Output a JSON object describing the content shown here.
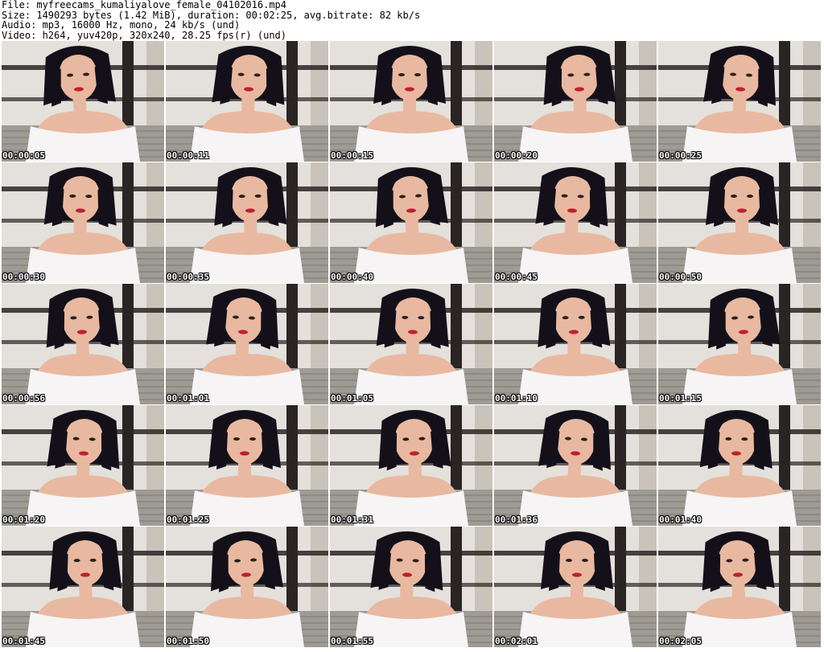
{
  "header": {
    "file": "File: myfreecams_kumaliyalove_female_04102016.mp4",
    "size": "Size: 1490293 bytes (1.42 MiB), duration: 00:02:25, avg.bitrate: 82 kb/s",
    "audio": "Audio: mp3, 16000 Hz, mono, 24 kb/s (und)",
    "video": "Video: h264, yuv420p, 320x240, 28.25 fps(r) (und)"
  },
  "thumbnails": [
    {
      "timestamp": "00:00:05"
    },
    {
      "timestamp": "00:00:11"
    },
    {
      "timestamp": "00:00:15"
    },
    {
      "timestamp": "00:00:20"
    },
    {
      "timestamp": "00:00:25"
    },
    {
      "timestamp": "00:00:30"
    },
    {
      "timestamp": "00:00:35"
    },
    {
      "timestamp": "00:00:40"
    },
    {
      "timestamp": "00:00:45"
    },
    {
      "timestamp": "00:00:50"
    },
    {
      "timestamp": "00:00:56"
    },
    {
      "timestamp": "00:01:01"
    },
    {
      "timestamp": "00:01:05"
    },
    {
      "timestamp": "00:01:10"
    },
    {
      "timestamp": "00:01:15"
    },
    {
      "timestamp": "00:01:20"
    },
    {
      "timestamp": "00:01:25"
    },
    {
      "timestamp": "00:01:31"
    },
    {
      "timestamp": "00:01:36"
    },
    {
      "timestamp": "00:01:40"
    },
    {
      "timestamp": "00:01:45"
    },
    {
      "timestamp": "00:01:50"
    },
    {
      "timestamp": "00:01:55"
    },
    {
      "timestamp": "00:02:01"
    },
    {
      "timestamp": "00:02:05"
    }
  ],
  "colors": {
    "wall": "#ddd8d2",
    "shelf": "#2a2424",
    "hair": "#14101a",
    "skin": "#e8b9a0",
    "dress": "#f6f4f5",
    "sofa": "#9e9a94",
    "lips": "#c0202c"
  }
}
